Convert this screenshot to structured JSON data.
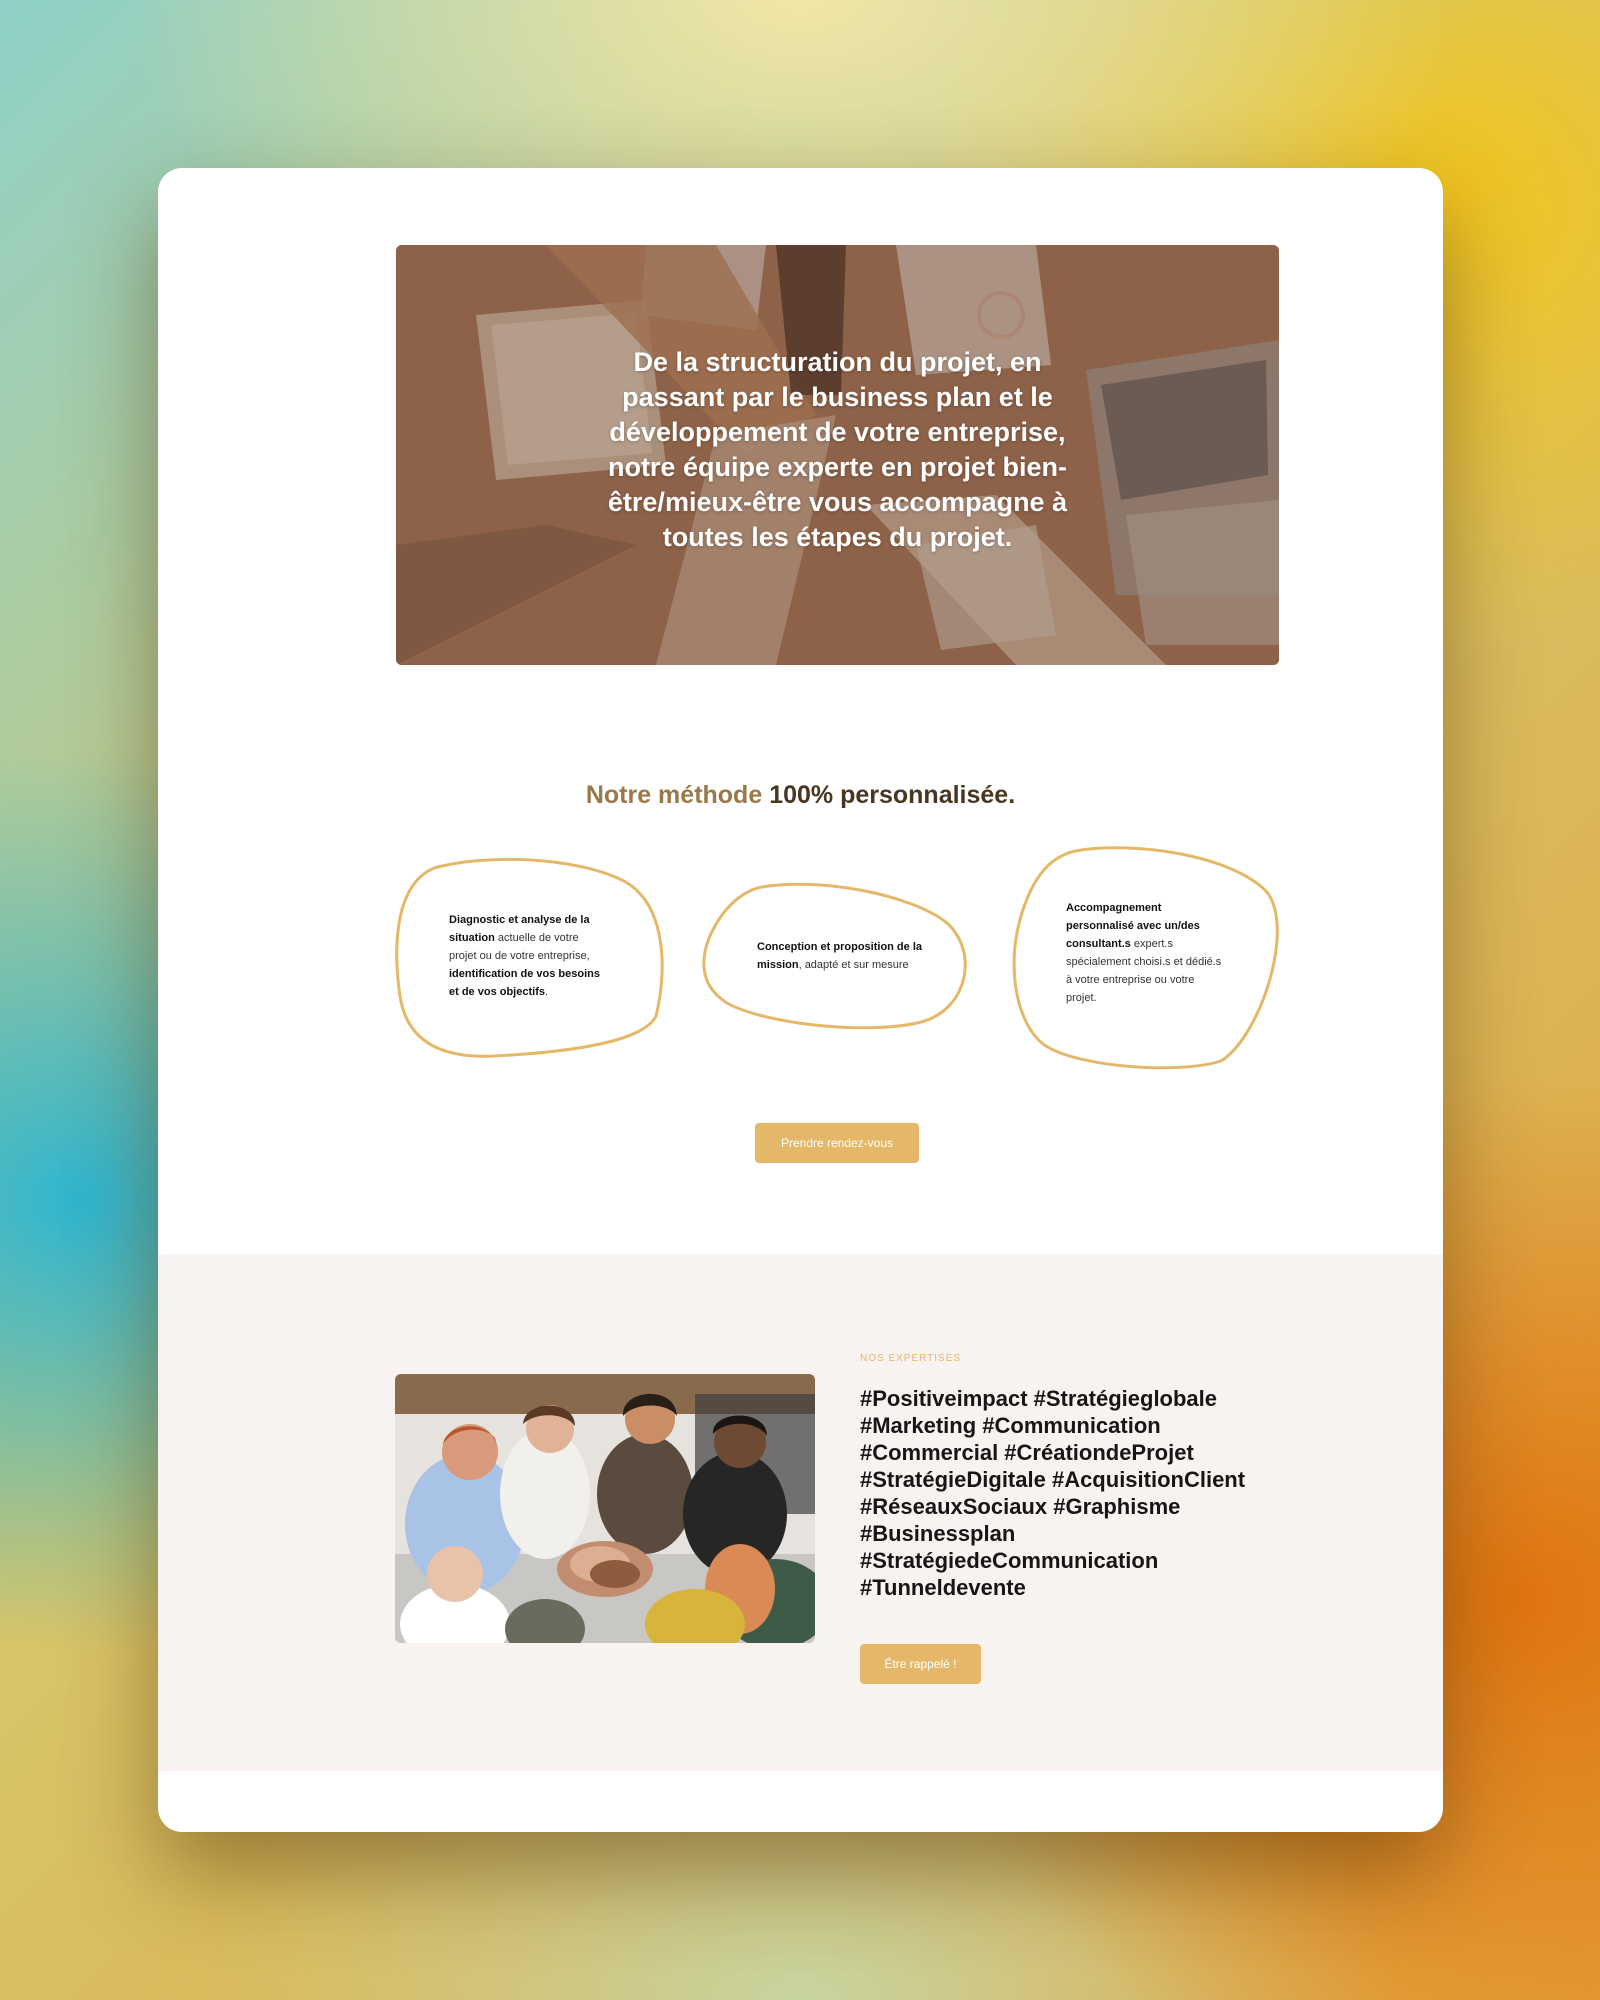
{
  "hero": {
    "text": "De la structuration du projet, en passant par le business plan et le développement de votre entreprise, notre équipe experte en projet bien-être/mieux-être vous accompagne à toutes les étapes du projet."
  },
  "method": {
    "title_highlight": "Notre méthode",
    "title_rest": "100% personnalisée.",
    "steps": [
      {
        "bold1": "Diagnostic et analyse de la situation",
        "text1": " actuelle de votre projet ou de votre entreprise, ",
        "bold2": "identification de vos besoins et de vos objectifs",
        "text2": "."
      },
      {
        "bold1": "Conception et proposition de la mission",
        "text1": ", adapté et sur mesure",
        "bold2": "",
        "text2": ""
      },
      {
        "bold1": "Accompagnement personnalisé avec un/des consultant.s",
        "text1": " expert.s spécialement choisi.s et dédié.s à votre entreprise ou votre projet.",
        "bold2": "",
        "text2": ""
      }
    ],
    "cta_label": "Prendre rendez-vous"
  },
  "expertises": {
    "eyebrow": "NOS EXPERTISES",
    "hashtag_lines": [
      "#Positiveimpact #Stratégieglobale",
      "#Marketing #Communication",
      "#Commercial #CréationdeProjet",
      "#StratégieDigitale #AcquisitionClient",
      "#RéseauxSociaux #Graphisme",
      "#Businessplan",
      "#StratégiedeCommunication",
      "#Tunneldevente"
    ],
    "cta_label": "Être rappelé !"
  },
  "colors": {
    "accent": "#e4b868",
    "title_highlight": "#9a7848",
    "section_bg": "#f8f2f0"
  }
}
